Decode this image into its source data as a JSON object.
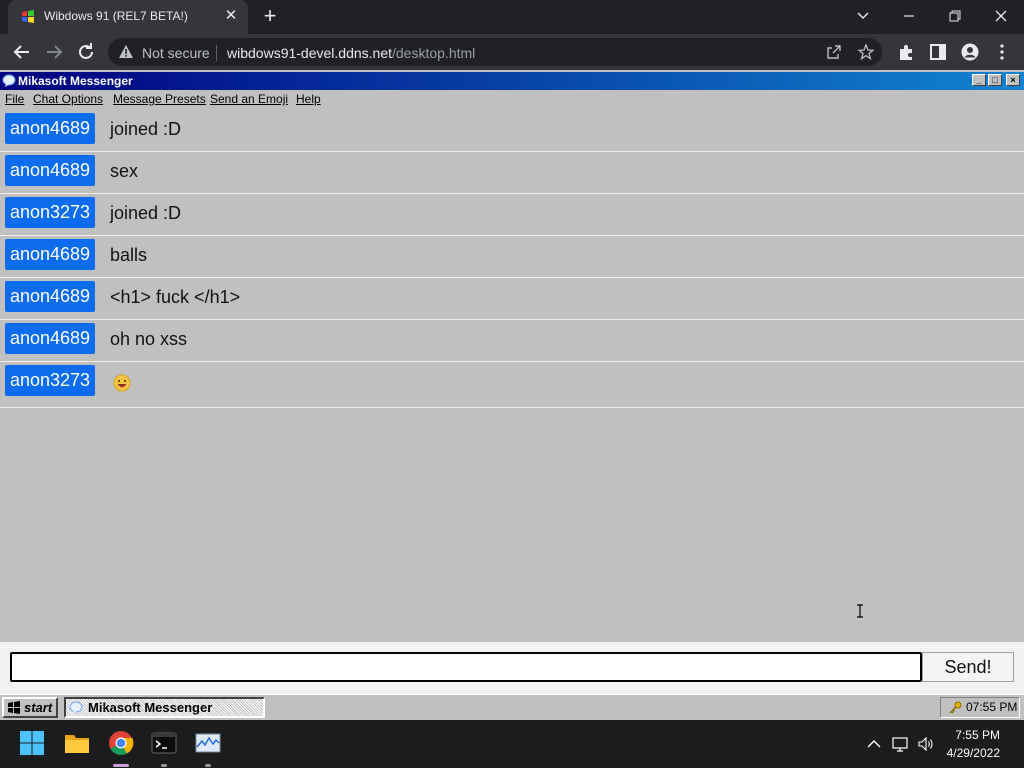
{
  "browser": {
    "tab_title": "Wibdows 91 (REL7 BETA!)",
    "security_label": "Not secure",
    "url_host": "wibdows91-devel.ddns.net",
    "url_path": "/desktop.html"
  },
  "app": {
    "title": "Mikasoft Messenger",
    "menu": [
      {
        "label": "File"
      },
      {
        "label": "Chat Options"
      },
      {
        "label": "Message Presets"
      },
      {
        "label": "Send an Emoji"
      },
      {
        "label": "Help"
      }
    ],
    "messages": [
      {
        "user": "anon4689",
        "text": "joined :D"
      },
      {
        "user": "anon4689",
        "text": "sex"
      },
      {
        "user": "anon3273",
        "text": "joined :D"
      },
      {
        "user": "anon4689",
        "text": "balls"
      },
      {
        "user": "anon4689",
        "text": "<h1> fuck </h1>"
      },
      {
        "user": "anon4689",
        "text": "oh no xss"
      },
      {
        "user": "anon3273",
        "text": "",
        "emoji": "grinning-face-emoji"
      }
    ],
    "input": {
      "value": "",
      "placeholder": ""
    },
    "send_label": "Send!"
  },
  "w91_taskbar": {
    "start_label": "start",
    "task_label": "Mikasoft Messenger",
    "tray_time": "07:55 PM"
  },
  "win_taskbar": {
    "apps": [
      "windows-start-icon",
      "file-explorer-icon",
      "chrome-icon",
      "terminal-icon",
      "task-manager-icon"
    ],
    "time": "7:55 PM",
    "date": "4/29/2022"
  },
  "colors": {
    "user_badge": "#0b6cf0",
    "titlebar_start": "#000080",
    "titlebar_end": "#1084d0",
    "window_bg": "#c0c0c0"
  }
}
